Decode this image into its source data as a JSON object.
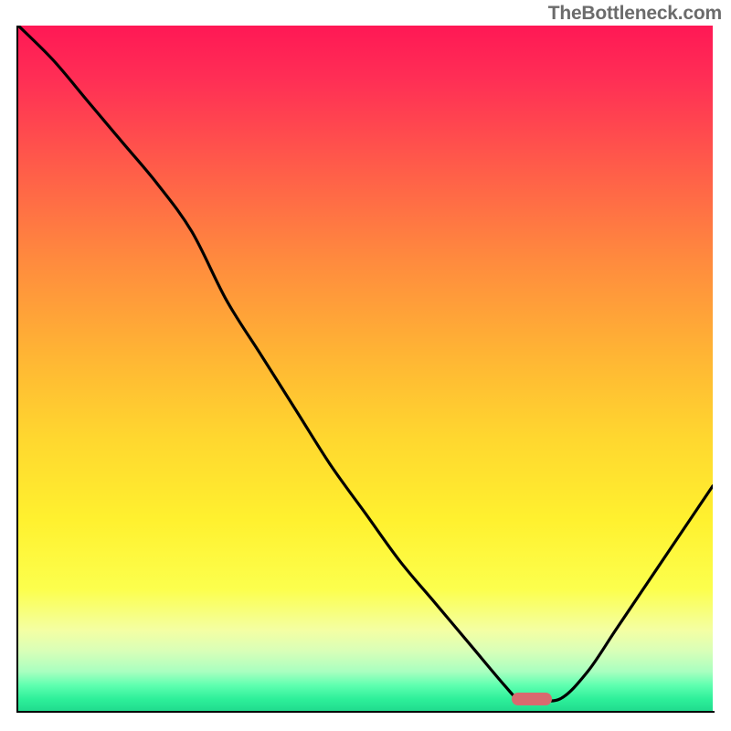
{
  "attribution": "TheBottleneck.com",
  "colors": {
    "curve_stroke": "#000000",
    "marker_fill": "#d96a6f",
    "axis": "#000000"
  },
  "chart_data": {
    "type": "line",
    "title": "",
    "xlabel": "",
    "ylabel": "",
    "xlim": [
      0,
      100
    ],
    "ylim": [
      0,
      100
    ],
    "annotations": [
      {
        "type": "marker",
        "x": 74,
        "y": 2,
        "shape": "pill"
      }
    ],
    "series": [
      {
        "name": "bottleneck-curve",
        "x": [
          0,
          5,
          10,
          15,
          20,
          25,
          30,
          35,
          40,
          45,
          50,
          55,
          60,
          65,
          70,
          72,
          74,
          78,
          82,
          86,
          90,
          94,
          98,
          100
        ],
        "y": [
          100,
          95,
          89,
          83,
          77,
          70,
          60,
          52,
          44,
          36,
          29,
          22,
          16,
          10,
          4,
          2,
          2,
          2,
          6,
          12,
          18,
          24,
          30,
          33
        ]
      }
    ],
    "gradient_stops": [
      {
        "pos": 0,
        "color": "#ff1855"
      },
      {
        "pos": 8,
        "color": "#ff2f55"
      },
      {
        "pos": 20,
        "color": "#ff5a4a"
      },
      {
        "pos": 34,
        "color": "#ff8a3e"
      },
      {
        "pos": 48,
        "color": "#ffb534"
      },
      {
        "pos": 60,
        "color": "#ffd72f"
      },
      {
        "pos": 72,
        "color": "#fff12f"
      },
      {
        "pos": 82,
        "color": "#fcff4d"
      },
      {
        "pos": 88,
        "color": "#f4ffa3"
      },
      {
        "pos": 91,
        "color": "#d9ffb8"
      },
      {
        "pos": 94,
        "color": "#a9ffc0"
      },
      {
        "pos": 96,
        "color": "#5fffb0"
      },
      {
        "pos": 98,
        "color": "#2ef09a"
      },
      {
        "pos": 100,
        "color": "#1fd88c"
      }
    ]
  }
}
